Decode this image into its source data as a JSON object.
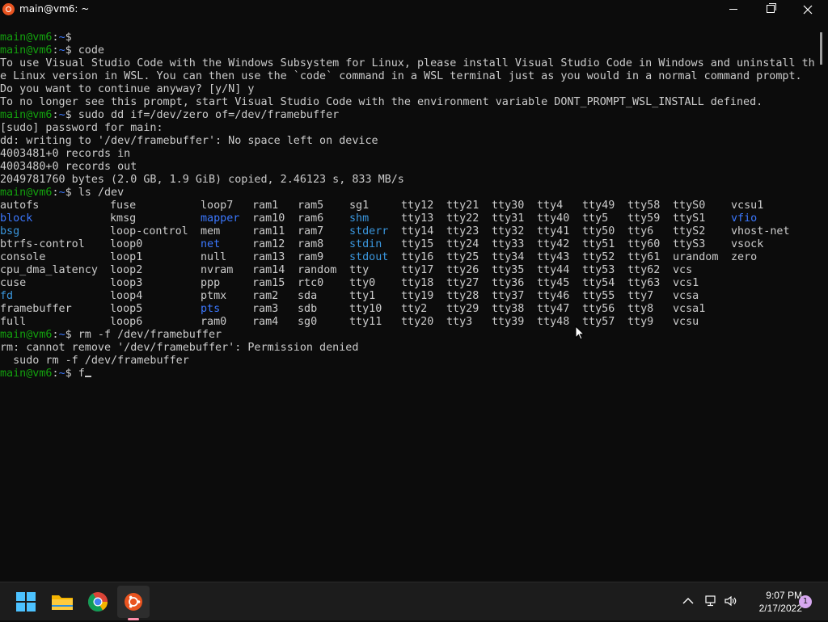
{
  "window": {
    "title": "main@vm6: ~",
    "controls": [
      "minimize",
      "maximize",
      "close"
    ]
  },
  "prompt": {
    "user_host": "main@vm6",
    "separator": ":",
    "path": "~",
    "symbol": "$"
  },
  "terminal": {
    "block1": [
      {
        "type": "prompt",
        "cmd": ""
      },
      {
        "type": "prompt",
        "cmd": " code"
      },
      {
        "type": "text",
        "text": "To use Visual Studio Code with the Windows Subsystem for Linux, please install Visual Studio Code in Windows and uninstall th"
      },
      {
        "type": "text",
        "text": "e Linux version in WSL. You can then use the `code` command in a WSL terminal just as you would in a normal command prompt."
      },
      {
        "type": "text",
        "text": "Do you want to continue anyway? [y/N] y"
      },
      {
        "type": "text",
        "text": "To no longer see this prompt, start Visual Studio Code with the environment variable DONT_PROMPT_WSL_INSTALL defined."
      },
      {
        "type": "prompt",
        "cmd": " sudo dd if=/dev/zero of=/dev/framebuffer"
      },
      {
        "type": "text",
        "text": "[sudo] password for main:"
      },
      {
        "type": "text",
        "text": "dd: writing to '/dev/framebuffer': No space left on device"
      },
      {
        "type": "text",
        "text": "4003481+0 records in"
      },
      {
        "type": "text",
        "text": "4003480+0 records out"
      },
      {
        "type": "text",
        "text": "2049781760 bytes (2.0 GB, 1.9 GiB) copied, 2.46123 s, 833 MB/s"
      },
      {
        "type": "prompt",
        "cmd": " ls /dev"
      }
    ],
    "ls_columns": [
      [
        "autofs",
        "block",
        "bsg",
        "btrfs-control",
        "console",
        "cpu_dma_latency",
        "cuse",
        "fd",
        "framebuffer",
        "full"
      ],
      [
        "fuse",
        "kmsg",
        "loop-control",
        "loop0",
        "loop1",
        "loop2",
        "loop3",
        "loop4",
        "loop5",
        "loop6"
      ],
      [
        "loop7",
        "mapper",
        "mem",
        "net",
        "null",
        "nvram",
        "ppp",
        "ptmx",
        "pts",
        "ram0"
      ],
      [
        "ram1",
        "ram10",
        "ram11",
        "ram12",
        "ram13",
        "ram14",
        "ram15",
        "ram2",
        "ram3",
        "ram4"
      ],
      [
        "ram5",
        "ram6",
        "ram7",
        "ram8",
        "ram9",
        "random",
        "rtc0",
        "sda",
        "sdb",
        "sg0"
      ],
      [
        "sg1",
        "shm",
        "stderr",
        "stdin",
        "stdout",
        "tty",
        "tty0",
        "tty1",
        "tty10",
        "tty11"
      ],
      [
        "tty12",
        "tty13",
        "tty14",
        "tty15",
        "tty16",
        "tty17",
        "tty18",
        "tty19",
        "tty2",
        "tty20"
      ],
      [
        "tty21",
        "tty22",
        "tty23",
        "tty24",
        "tty25",
        "tty26",
        "tty27",
        "tty28",
        "tty29",
        "tty3"
      ],
      [
        "tty30",
        "tty31",
        "tty32",
        "tty33",
        "tty34",
        "tty35",
        "tty36",
        "tty37",
        "tty38",
        "tty39"
      ],
      [
        "tty4",
        "tty40",
        "tty41",
        "tty42",
        "tty43",
        "tty44",
        "tty45",
        "tty46",
        "tty47",
        "tty48"
      ],
      [
        "tty49",
        "tty5",
        "tty50",
        "tty51",
        "tty52",
        "tty53",
        "tty54",
        "tty55",
        "tty56",
        "tty57"
      ],
      [
        "tty58",
        "tty59",
        "tty6",
        "tty60",
        "tty61",
        "tty62",
        "tty63",
        "tty7",
        "tty8",
        "tty9"
      ],
      [
        "ttyS0",
        "ttyS1",
        "ttyS2",
        "ttyS3",
        "urandom",
        "vcs",
        "vcs1",
        "vcsa",
        "vcsa1",
        "vcsu"
      ],
      [
        "vcsu1",
        "vfio",
        "vhost-net",
        "vsock",
        "zero",
        "",
        "",
        "",
        "",
        ""
      ]
    ],
    "ls_colored": {
      "blue": [
        "block",
        "mapper",
        "net",
        "pts",
        "vfio"
      ],
      "cyan": [
        "bsg",
        "fd",
        "shm",
        "stderr",
        "stdin",
        "stdout"
      ]
    },
    "block2": [
      {
        "type": "prompt",
        "cmd": " rm -f /dev/framebuffer"
      },
      {
        "type": "text",
        "text": "rm: cannot remove '/dev/framebuffer': Permission denied"
      },
      {
        "type": "plain",
        "text": "  sudo rm -f /dev/framebuffer"
      },
      {
        "type": "prompt",
        "cmd": " f",
        "cursor": true
      }
    ]
  },
  "colors": {
    "background": "#0c0c0c",
    "foreground": "#cccccc",
    "prompt_user": "#13a10e",
    "prompt_path": "#3b78ff",
    "dir_blue": "#3b78ff",
    "link_cyan": "#3a96dd",
    "taskbar": "#1c1c1c",
    "ubuntu_orange": "#e95420"
  },
  "taskbar": {
    "apps": [
      {
        "name": "start",
        "icon": "windows-logo-icon"
      },
      {
        "name": "file-explorer",
        "icon": "folder-icon"
      },
      {
        "name": "chrome",
        "icon": "chrome-icon"
      },
      {
        "name": "ubuntu",
        "icon": "ubuntu-icon",
        "active": true
      }
    ],
    "tray_icons": [
      "chevron-up-icon",
      "network-icon",
      "volume-icon"
    ],
    "time": "9:07 PM",
    "date": "2/17/2022",
    "notification_count": "1"
  }
}
